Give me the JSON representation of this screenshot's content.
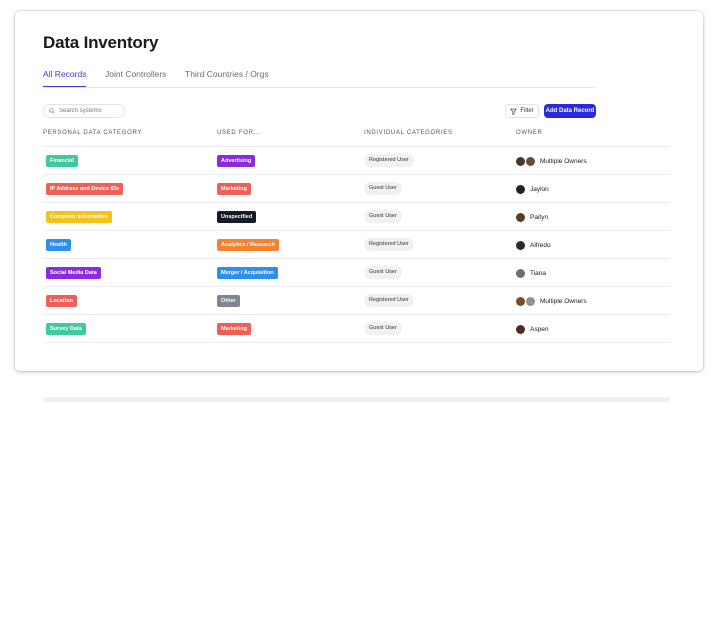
{
  "page": {
    "title": "Data Inventory"
  },
  "tabs": [
    {
      "label": "All Records",
      "active": true
    },
    {
      "label": "Joint Controllers",
      "active": false
    },
    {
      "label": "Third Countries / Orgs",
      "active": false
    }
  ],
  "toolbar": {
    "search_placeholder": "Search systems",
    "filter_label": "Filter",
    "add_label": "Add Data Record"
  },
  "columns": [
    "PERSONAL DATA CATEGORY",
    "USED FOR...",
    "INDIVIDUAL CATEGORIES",
    "OWNER"
  ],
  "rows": [
    {
      "category": "Financial",
      "category_color": "#3ec9a0",
      "used_for": "Advertising",
      "used_for_color": "#8a2be2",
      "individual": "Registered User",
      "owner": "Multiple Owners",
      "avatars": [
        "#4a3728",
        "#6b4a3a"
      ]
    },
    {
      "category": "IP Address and Device IDs",
      "category_color": "#ef5f57",
      "used_for": "Marketing",
      "used_for_color": "#ef5f57",
      "individual": "Guest User",
      "owner": "Jaylon",
      "avatars": [
        "#222222"
      ]
    },
    {
      "category": "Computer Information",
      "category_color": "#f2c31a",
      "used_for": "Unspecified",
      "used_for_color": "#151a26",
      "individual": "Guest User",
      "owner": "Paityn",
      "avatars": [
        "#5a3d2b"
      ]
    },
    {
      "category": "Health",
      "category_color": "#2e8ef0",
      "used_for": "Analytics / Research",
      "used_for_color": "#f4822e",
      "individual": "Registered User",
      "owner": "Alfredo",
      "avatars": [
        "#2b2b2b"
      ]
    },
    {
      "category": "Social Media Data",
      "category_color": "#8a2be2",
      "used_for": "Merger / Acquisition",
      "used_for_color": "#2e8ef0",
      "individual": "Guest User",
      "owner": "Tiana",
      "avatars": [
        "#6e6e6e"
      ]
    },
    {
      "category": "Location",
      "category_color": "#ef5f57",
      "used_for": "Other",
      "used_for_color": "#7d8590",
      "individual": "Registered User",
      "owner": "Multiple Owners",
      "avatars": [
        "#7a4a30",
        "#909090"
      ]
    },
    {
      "category": "Survey Data",
      "category_color": "#3ec9a0",
      "used_for": "Marketing",
      "used_for_color": "#ef5f57",
      "individual": "Guest User",
      "owner": "Aspen",
      "avatars": [
        "#4a2e24"
      ]
    }
  ],
  "colors": {
    "accent": "#2929e0",
    "tab_active": "#3b3bd6"
  }
}
